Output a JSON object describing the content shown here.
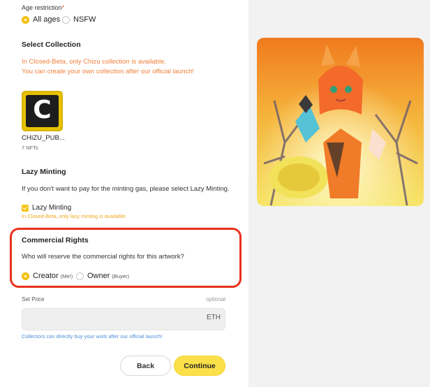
{
  "age_restriction": {
    "label": "Age restriction",
    "required_mark": "*",
    "options": [
      "All ages",
      "NSFW"
    ],
    "selected": "All ages"
  },
  "collection": {
    "title": "Select Collection",
    "warning_line1": "In Closed-Beta, only Chizu collection is available.",
    "warning_line2": "You can create your own collection after our official launch!",
    "item_name": "CHIZU_PUB...",
    "item_count": "7 NFTs",
    "thumb_letter": "C"
  },
  "lazy_minting": {
    "title": "Lazy Minting",
    "description": "If you don't want to pay for the minting gas, please select Lazy Minting.",
    "checkbox_label": "Lazy Minting",
    "checked": true,
    "note": "In Closed-Beta, only lazy minting is available."
  },
  "commercial_rights": {
    "title": "Commercial Rights",
    "question": "Who will reserve the commercial rights for this artwork?",
    "creator_label": "Creator",
    "creator_note": "(Me!)",
    "owner_label": "Owner",
    "owner_note": "(Buyer)",
    "selected": "Creator"
  },
  "price": {
    "label": "Set Price",
    "optional": "optional",
    "currency": "ETH",
    "value": "",
    "note": "Collectors can directly buy your work after our official launch!"
  },
  "actions": {
    "back": "Back",
    "continue": "Continue"
  },
  "colors": {
    "accent_yellow": "#f7c515",
    "warning_orange": "#f07f3c",
    "highlight_red": "#e8301c",
    "link_blue": "#4a8fd8"
  }
}
